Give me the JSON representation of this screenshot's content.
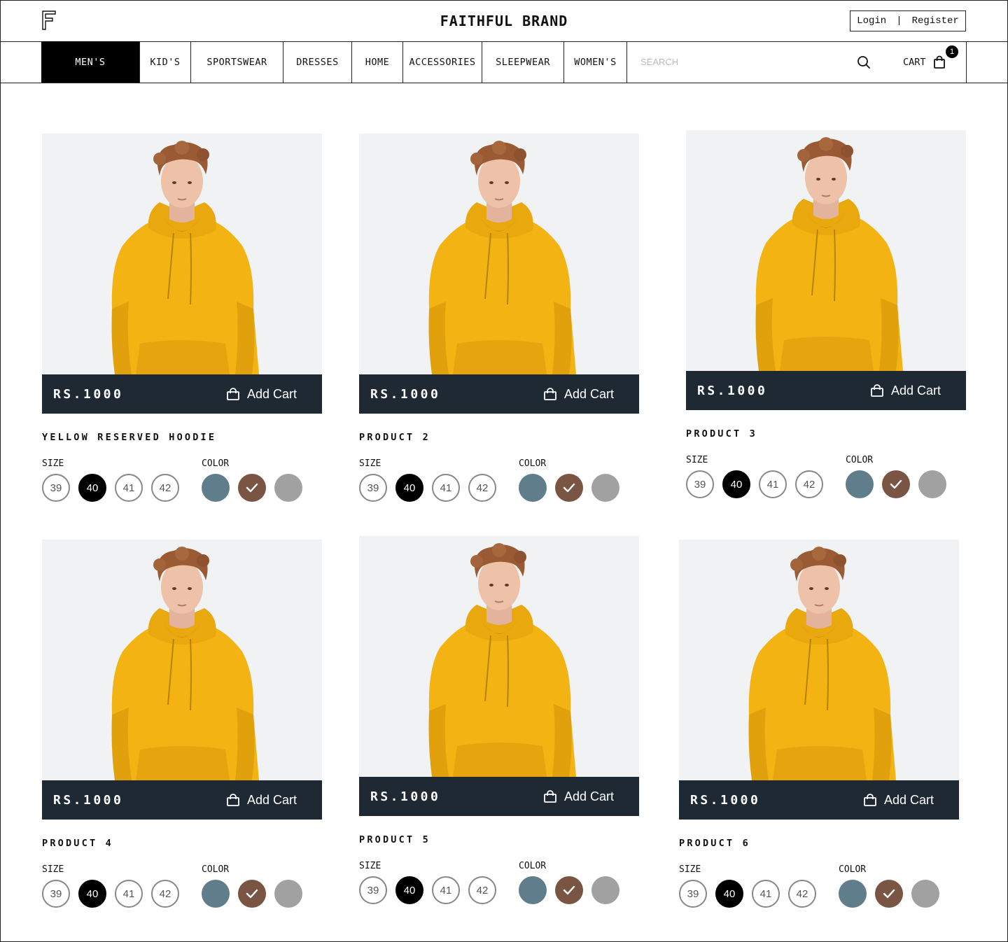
{
  "header": {
    "brand": "FAITHFUL BRAND",
    "login_label": "Login",
    "separator": "|",
    "register_label": "Register"
  },
  "nav": {
    "items": [
      {
        "label": "MEN'S",
        "active": true
      },
      {
        "label": "KID'S"
      },
      {
        "label": "SPORTSWEAR"
      },
      {
        "label": "DRESSES"
      },
      {
        "label": "HOME"
      },
      {
        "label": "ACCESSORIES"
      },
      {
        "label": "SLEEPWEAR"
      },
      {
        "label": "WOMEN'S"
      }
    ],
    "search_placeholder": "SEARCH",
    "cart_label": "CART",
    "cart_count": "1"
  },
  "colors": {
    "pricebar": "#1f2933",
    "swatch_blue": "#5f7d8a",
    "swatch_brown": "#7a5544",
    "swatch_gray": "#a1a1a1",
    "hoodie": "#f2b313"
  },
  "products": [
    {
      "name": "YELLOW RESERVED HOODIE",
      "price": "RS.1000",
      "add_label": "Add Cart",
      "size_label": "SIZE",
      "color_label": "COLOR",
      "sizes": [
        "39",
        "40",
        "41",
        "42"
      ],
      "selected_size": "40",
      "selected_color": "brown"
    },
    {
      "name": "PRODUCT 2",
      "price": "RS.1000",
      "add_label": "Add Cart",
      "size_label": "SIZE",
      "color_label": "COLOR",
      "sizes": [
        "39",
        "40",
        "41",
        "42"
      ],
      "selected_size": "40",
      "selected_color": "brown"
    },
    {
      "name": "PRODUCT 3",
      "price": "RS.1000",
      "add_label": "Add Cart",
      "size_label": "SIZE",
      "color_label": "COLOR",
      "sizes": [
        "39",
        "40",
        "41",
        "42"
      ],
      "selected_size": "40",
      "selected_color": "brown"
    },
    {
      "name": "PRODUCT 4",
      "price": "RS.1000",
      "add_label": "Add Cart",
      "size_label": "SIZE",
      "color_label": "COLOR",
      "sizes": [
        "39",
        "40",
        "41",
        "42"
      ],
      "selected_size": "40",
      "selected_color": "brown"
    },
    {
      "name": "PRODUCT 5",
      "price": "RS.1000",
      "add_label": "Add Cart",
      "size_label": "SIZE",
      "color_label": "COLOR",
      "sizes": [
        "39",
        "40",
        "41",
        "42"
      ],
      "selected_size": "40",
      "selected_color": "brown"
    },
    {
      "name": "PRODUCT 6",
      "price": "RS.1000",
      "add_label": "Add Cart",
      "size_label": "SIZE",
      "color_label": "COLOR",
      "sizes": [
        "39",
        "40",
        "41",
        "42"
      ],
      "selected_size": "40",
      "selected_color": "brown"
    }
  ]
}
